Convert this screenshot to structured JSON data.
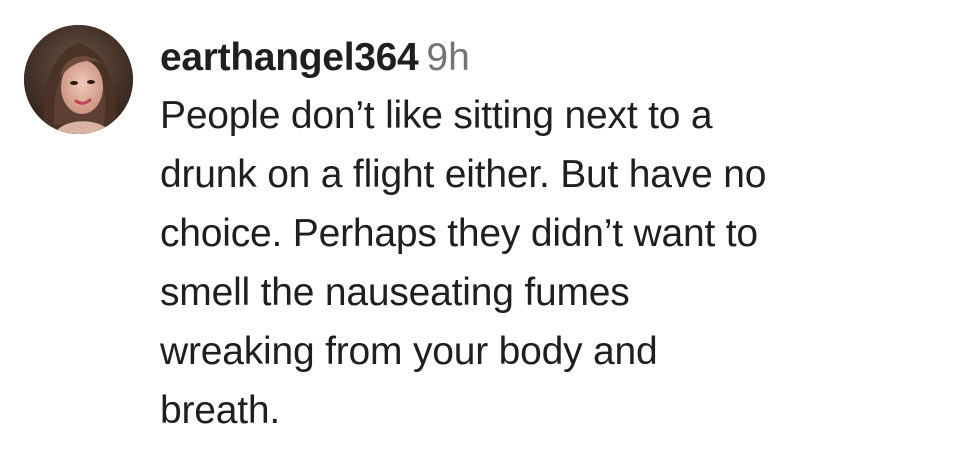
{
  "comment": {
    "username": "earthangel364",
    "timestamp": "9h",
    "avatar_icon": "user-avatar-photo",
    "text_lines": [
      "People don’t like sitting next to a",
      "drunk on a flight either. But have no",
      "choice. Perhaps they didn’t want to",
      "smell the nauseating fumes",
      "wreaking from your body and",
      "breath."
    ]
  },
  "colors": {
    "text": "#1f1f1f",
    "timestamp": "#737373",
    "background": "#ffffff"
  }
}
